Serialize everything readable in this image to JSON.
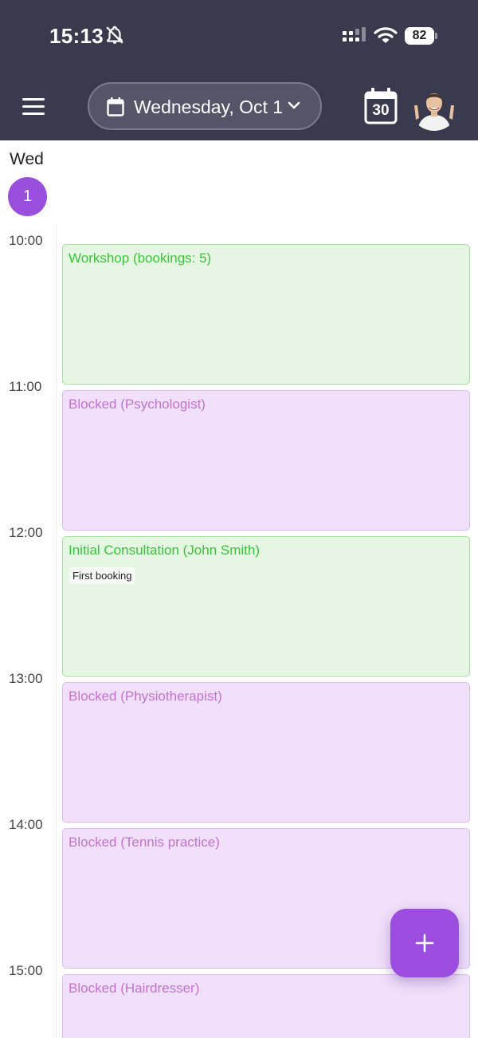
{
  "status_bar": {
    "time": "15:13",
    "battery": "82"
  },
  "header": {
    "date_label": "Wednesday, Oct 1",
    "calendar_day": "30"
  },
  "day": {
    "name": "Wed",
    "number": "1"
  },
  "time_labels": [
    "10:00",
    "11:00",
    "12:00",
    "13:00",
    "14:00",
    "15:00"
  ],
  "events": [
    {
      "title": "Workshop (bookings: 5)",
      "type": "green"
    },
    {
      "title": "Blocked (Psychologist)",
      "type": "purple"
    },
    {
      "title": "Initial Consultation (John Smith)",
      "type": "green",
      "note": "First booking"
    },
    {
      "title": "Blocked (Physiotherapist)",
      "type": "purple"
    },
    {
      "title": "Blocked (Tennis practice)",
      "type": "purple"
    },
    {
      "title": "Blocked (Hairdresser)",
      "type": "purple"
    }
  ],
  "colors": {
    "header_bg": "#3a3a4e",
    "accent": "#9a4fdc",
    "green_event_bg": "#e5f6e3",
    "green_event_text": "#3ac43a",
    "purple_event_bg": "#f0e0fb",
    "purple_event_text": "#c472cf"
  },
  "icons": [
    "bell-off-icon",
    "signal-icon",
    "wifi-icon",
    "battery-icon",
    "menu-icon",
    "calendar-icon",
    "chevron-down-icon",
    "calendar-today-icon",
    "avatar",
    "plus-icon"
  ]
}
